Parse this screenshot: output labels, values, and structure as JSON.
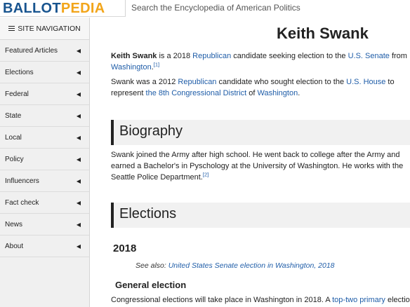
{
  "header": {
    "logo_part1": "BALLOT",
    "logo_part2": "PEDIA",
    "search_placeholder": "Search the Encyclopedia of American Politics",
    "logo_colors": {
      "primary": "#18548f",
      "accent": "#f2a51a"
    }
  },
  "sidebar": {
    "title": "SITE NAVIGATION",
    "items": [
      {
        "label": "Featured Articles"
      },
      {
        "label": "Elections"
      },
      {
        "label": "Federal"
      },
      {
        "label": "State"
      },
      {
        "label": "Local"
      },
      {
        "label": "Policy"
      },
      {
        "label": "Influencers"
      },
      {
        "label": "Fact check"
      },
      {
        "label": "News"
      },
      {
        "label": "About"
      }
    ]
  },
  "article": {
    "title": "Keith Swank",
    "intro1": {
      "name": "Keith Swank",
      "t1": " is a 2018 ",
      "link1": "Republican",
      "t2": " candidate seeking election to the ",
      "link2": "U.S. Senate",
      "t3": " from ",
      "link3": "Washington",
      "t4": ".",
      "ref": "[1]"
    },
    "intro2": {
      "t1": "Swank was a 2012 ",
      "link1": "Republican",
      "t2": " candidate who sought election to the ",
      "link2": "U.S. House",
      "t3": " to represent ",
      "link3": "the 8th Congressional District",
      "t4": " of ",
      "link4": "Washington",
      "t5": "."
    },
    "biography_heading": "Biography",
    "biography_text": "Swank joined the Army after high school. He went back to college after the Army and earned a Bachelor's in Pyschology at the University of Washington. He works with the Seattle Police Department.",
    "biography_ref": "[2]",
    "elections_heading": "Elections",
    "year_heading": "2018",
    "see_also_label": "See also: ",
    "see_also_link": "United States Senate election in Washington, 2018",
    "general_heading": "General election",
    "general_text1": "Congressional elections will take place in Washington in 2018. A ",
    "general_link": "top-two primary",
    "general_text2": " election"
  }
}
